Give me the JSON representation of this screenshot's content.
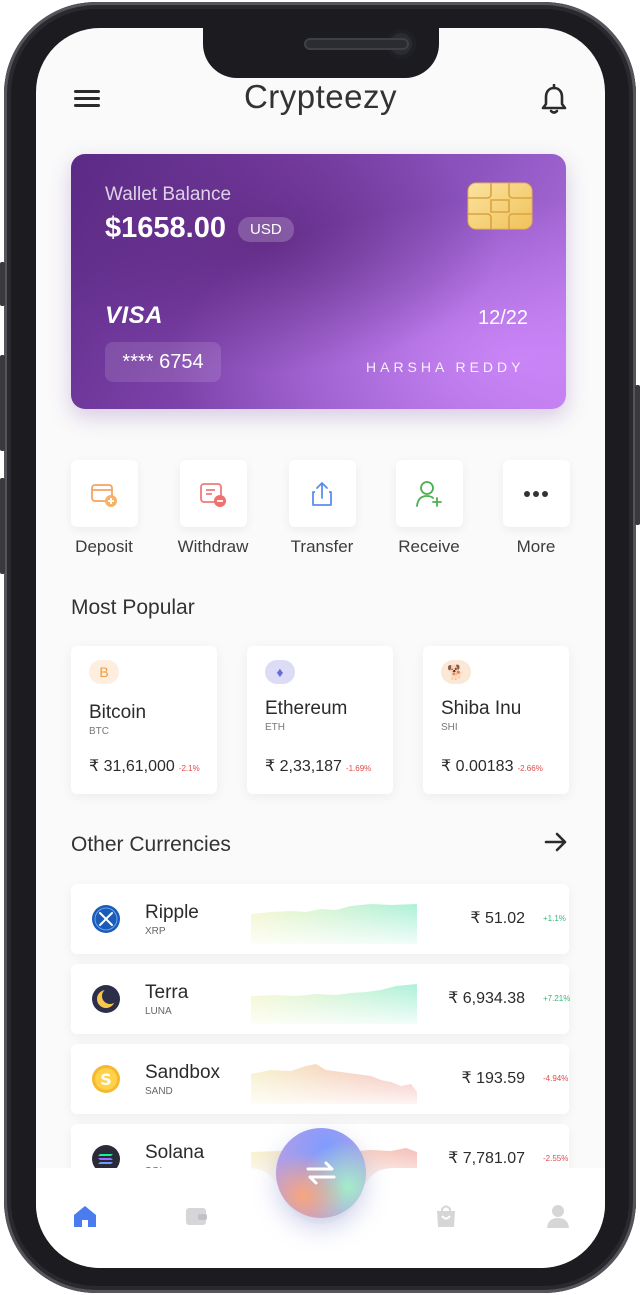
{
  "header": {
    "title": "Crypteezy"
  },
  "card": {
    "label": "Wallet Balance",
    "balance": "$1658.00",
    "currency": "USD",
    "network": "VISA",
    "expiry": "12/22",
    "masked_number": "**** 6754",
    "holder": "HARSHA REDDY"
  },
  "actions": [
    {
      "label": "Deposit",
      "icon": "wallet-add-icon"
    },
    {
      "label": "Withdraw",
      "icon": "wallet-remove-icon"
    },
    {
      "label": "Transfer",
      "icon": "share-upload-icon"
    },
    {
      "label": "Receive",
      "icon": "user-add-icon"
    },
    {
      "label": "More",
      "icon": "more-dots-icon"
    }
  ],
  "popular": {
    "title": "Most Popular",
    "items": [
      {
        "name": "Bitcoin",
        "symbol": "BTC",
        "price": "₹ 31,61,000",
        "change": "-2.1%",
        "badge": "B"
      },
      {
        "name": "Ethereum",
        "symbol": "ETH",
        "price": "₹ 2,33,187",
        "change": "-1.69%",
        "badge": "♦"
      },
      {
        "name": "Shiba Inu",
        "symbol": "SHI",
        "price": "₹ 0.00183",
        "change": "-2.66%",
        "badge": "🐕"
      }
    ]
  },
  "other": {
    "title": "Other Currencies",
    "items": [
      {
        "name": "Ripple",
        "symbol": "XRP",
        "price": "₹ 51.02",
        "change": "+1.1%",
        "trend": "up"
      },
      {
        "name": "Terra",
        "symbol": "LUNA",
        "price": "₹ 6,934.38",
        "change": "+7.21%",
        "trend": "up"
      },
      {
        "name": "Sandbox",
        "symbol": "SAND",
        "price": "₹ 193.59",
        "change": "-4.94%",
        "trend": "down"
      },
      {
        "name": "Solana",
        "symbol": "SOL",
        "price": "₹ 7,781.07",
        "change": "-2.55%",
        "trend": "down"
      }
    ]
  },
  "nav": [
    "home-icon",
    "wallet-icon",
    "swap-icon",
    "bag-icon",
    "profile-icon"
  ],
  "colors": {
    "accent": "#7a3fa6",
    "up": "#3bb77e",
    "down": "#e04b4b",
    "nav_active": "#4a7cf0"
  }
}
